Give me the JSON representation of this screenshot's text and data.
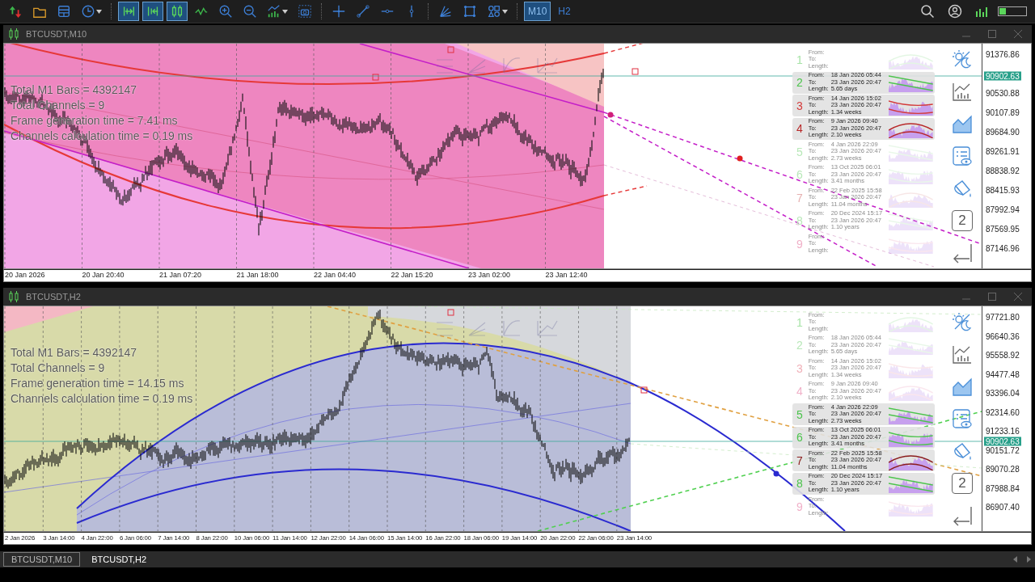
{
  "toolbar": {
    "tool_groups": [
      [
        {
          "kind": "arrows",
          "selected": false
        },
        {
          "kind": "folder",
          "selected": false
        },
        {
          "kind": "window",
          "selected": false
        },
        {
          "kind": "clock",
          "selected": false
        }
      ],
      [
        {
          "kind": "autoscroll",
          "selected": true
        },
        {
          "kind": "shift",
          "selected": true
        },
        {
          "kind": "candles",
          "selected": true
        },
        {
          "kind": "line",
          "selected": false
        },
        {
          "kind": "zoomin",
          "selected": false
        },
        {
          "kind": "zoomout",
          "selected": false
        },
        {
          "kind": "indicators",
          "selected": false
        },
        {
          "kind": "screenshot",
          "selected": false
        }
      ],
      [
        {
          "kind": "crosshair",
          "selected": false
        },
        {
          "kind": "trendline",
          "selected": false
        },
        {
          "kind": "hline",
          "selected": false
        },
        {
          "kind": "vline",
          "selected": false
        }
      ],
      [
        {
          "kind": "fan",
          "selected": false
        },
        {
          "kind": "rectangle",
          "selected": false
        },
        {
          "kind": "shapes",
          "selected": false
        }
      ]
    ],
    "timeframes": [
      {
        "label": "M10",
        "selected": true
      },
      {
        "label": "H2",
        "selected": false
      }
    ]
  },
  "charts": [
    {
      "title": "BTCUSDT,M10",
      "kind": "linear",
      "page_button": "2",
      "stats": [
        "Total M1 Bars = 4392147",
        "Total Channels = 9",
        "Frame generation time = 7.41 ms",
        "Channels calculation time = 0.19 ms"
      ],
      "price_labels": [
        "91376.86",
        "90530.88",
        "90107.89",
        "89684.90",
        "89261.91",
        "88838.92",
        "88415.93",
        "87992.94",
        "87569.95",
        "87146.96"
      ],
      "current_price": "90902.63",
      "time_labels": [
        "20 Jan 2026",
        "20 Jan 20:40",
        "21 Jan 07:20",
        "21 Jan 18:00",
        "22 Jan 04:40",
        "22 Jan 15:20",
        "23 Jan 02:00",
        "23 Jan 12:40"
      ],
      "channels": [
        {
          "number": "1",
          "color": "#a6e3a6",
          "highlighted": false,
          "lines": [
            {
              "label": "From:"
            },
            {
              "label": "To:"
            },
            {
              "label": "Length:"
            }
          ]
        },
        {
          "number": "2",
          "color": "#4cc44c",
          "highlighted": true,
          "lines": [
            {
              "label": "From:",
              "value": "18 Jan 2026 05:44"
            },
            {
              "label": "To:",
              "value": "23 Jan 2026 20:47"
            },
            {
              "label": "Length:",
              "value": "5.65 days"
            }
          ]
        },
        {
          "number": "3",
          "color": "#d43a3a",
          "highlighted": true,
          "lines": [
            {
              "label": "From:",
              "value": "14 Jan 2026 15:02"
            },
            {
              "label": "To:",
              "value": "23 Jan 2026 20:47"
            },
            {
              "label": "Length:",
              "value": "1.34 weeks"
            }
          ]
        },
        {
          "number": "4",
          "color": "#b82828",
          "highlighted": true,
          "lines": [
            {
              "label": "From:",
              "value": "9 Jan 2026 09:40"
            },
            {
              "label": "To:",
              "value": "23 Jan 2026 20:47"
            },
            {
              "label": "Length:",
              "value": "2.10 weeks"
            }
          ]
        },
        {
          "number": "5",
          "color": "#b8e8b8",
          "highlighted": false,
          "lines": [
            {
              "label": "From:",
              "value": "4 Jan 2026 22:09"
            },
            {
              "label": "To:",
              "value": "23 Jan 2026 20:47"
            },
            {
              "label": "Length:",
              "value": "2.73 weeks"
            }
          ]
        },
        {
          "number": "6",
          "color": "#b8e8b8",
          "highlighted": false,
          "lines": [
            {
              "label": "From:",
              "value": "13 Oct 2025 06:01"
            },
            {
              "label": "To:",
              "value": "23 Jan 2026 20:47"
            },
            {
              "label": "Length:",
              "value": "3.41 months"
            }
          ]
        },
        {
          "number": "7",
          "color": "#e6b0b0",
          "highlighted": false,
          "lines": [
            {
              "label": "From:",
              "value": "22 Feb 2025 15:58"
            },
            {
              "label": "To:",
              "value": "23 Jan 2026 20:47"
            },
            {
              "label": "Length:",
              "value": "11.04 months"
            }
          ]
        },
        {
          "number": "8",
          "color": "#b8e8b8",
          "highlighted": false,
          "lines": [
            {
              "label": "From:",
              "value": "20 Dec 2024 15:17"
            },
            {
              "label": "To:",
              "value": "23 Jan 2026 20:47"
            },
            {
              "label": "Length:",
              "value": "1.10 years"
            }
          ]
        },
        {
          "number": "9",
          "color": "#f0b0c8",
          "highlighted": false,
          "lines": [
            {
              "label": "From:"
            },
            {
              "label": "To:"
            },
            {
              "label": "Length:"
            }
          ]
        }
      ]
    },
    {
      "title": "BTCUSDT,H2",
      "kind": "arc",
      "page_button": "2",
      "stats": [
        "Total M1 Bars = 4392147",
        "Total Channels = 9",
        "Frame generation time = 14.15 ms",
        "Channels calculation time = 0.19 ms"
      ],
      "price_labels": [
        "97721.80",
        "96640.36",
        "95558.92",
        "94477.48",
        "93396.04",
        "92314.60",
        "91233.16",
        "90151.72",
        "89070.28",
        "87988.84",
        "86907.40"
      ],
      "current_price": "90902.63",
      "time_labels": [
        "2 Jan 2026",
        "3 Jan 14:00",
        "4 Jan 22:00",
        "6 Jan 06:00",
        "7 Jan 14:00",
        "8 Jan 22:00",
        "10 Jan 06:00",
        "11 Jan 14:00",
        "12 Jan 22:00",
        "14 Jan 06:00",
        "15 Jan 14:00",
        "16 Jan 22:00",
        "18 Jan 06:00",
        "19 Jan 14:00",
        "20 Jan 22:00",
        "22 Jan 06:00",
        "23 Jan 14:00"
      ],
      "channels": [
        {
          "number": "1",
          "color": "#a6e3a6",
          "highlighted": false,
          "lines": [
            {
              "label": "From:"
            },
            {
              "label": "To:"
            },
            {
              "label": "Length:"
            }
          ]
        },
        {
          "number": "2",
          "color": "#b8e8b8",
          "highlighted": false,
          "lines": [
            {
              "label": "From:",
              "value": "18 Jan 2026 05:44"
            },
            {
              "label": "To:",
              "value": "23 Jan 2026 20:47"
            },
            {
              "label": "Length:",
              "value": "5.65 days"
            }
          ]
        },
        {
          "number": "3",
          "color": "#f0b0b8",
          "highlighted": false,
          "lines": [
            {
              "label": "From:",
              "value": "14 Jan 2026 15:02"
            },
            {
              "label": "To:",
              "value": "23 Jan 2026 20:47"
            },
            {
              "label": "Length:",
              "value": "1.34 weeks"
            }
          ]
        },
        {
          "number": "4",
          "color": "#f0b0c8",
          "highlighted": false,
          "lines": [
            {
              "label": "From:",
              "value": "9 Jan 2026 09:40"
            },
            {
              "label": "To:",
              "value": "23 Jan 2026 20:47"
            },
            {
              "label": "Length:",
              "value": "2.10 weeks"
            }
          ]
        },
        {
          "number": "5",
          "color": "#4cc44c",
          "highlighted": true,
          "lines": [
            {
              "label": "From:",
              "value": "4 Jan 2026 22:09"
            },
            {
              "label": "To:",
              "value": "23 Jan 2026 20:47"
            },
            {
              "label": "Length:",
              "value": "2.73 weeks"
            }
          ]
        },
        {
          "number": "6",
          "color": "#4cc44c",
          "highlighted": true,
          "lines": [
            {
              "label": "From:",
              "value": "13 Oct 2025 06:01"
            },
            {
              "label": "To:",
              "value": "23 Jan 2026 20:47"
            },
            {
              "label": "Length:",
              "value": "3.41 months"
            }
          ]
        },
        {
          "number": "7",
          "color": "#8a1c1c",
          "highlighted": true,
          "lines": [
            {
              "label": "From:",
              "value": "22 Feb 2025 15:58"
            },
            {
              "label": "To:",
              "value": "23 Jan 2026 20:47"
            },
            {
              "label": "Length:",
              "value": "11.04 months"
            }
          ]
        },
        {
          "number": "8",
          "color": "#4cc44c",
          "highlighted": true,
          "lines": [
            {
              "label": "From:",
              "value": "20 Dec 2024 15:17"
            },
            {
              "label": "To:",
              "value": "23 Jan 2026 20:47"
            },
            {
              "label": "Length:",
              "value": "1.10 years"
            }
          ]
        },
        {
          "number": "9",
          "color": "#f0b0c8",
          "highlighted": false,
          "lines": [
            {
              "label": "From:"
            },
            {
              "label": "To:"
            },
            {
              "label": "Length:"
            }
          ]
        }
      ]
    }
  ],
  "tabs": [
    {
      "label": "BTCUSDT,M10",
      "selected": false
    },
    {
      "label": "BTCUSDT,H2",
      "selected": true
    }
  ]
}
